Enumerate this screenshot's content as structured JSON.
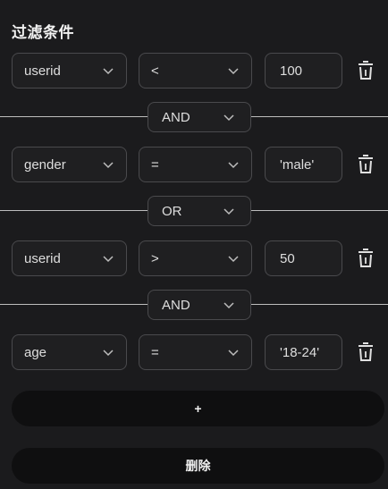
{
  "panel": {
    "title": "过滤条件"
  },
  "conditions": [
    {
      "field": "userid",
      "operator": "<",
      "value": "100"
    },
    {
      "field": "gender",
      "operator": "=",
      "value": "'male'"
    },
    {
      "field": "userid",
      "operator": ">",
      "value": "50"
    },
    {
      "field": "age",
      "operator": "=",
      "value": "'18-24'"
    }
  ],
  "connectors": [
    "AND",
    "OR",
    "AND"
  ],
  "buttons": {
    "add_label": "+",
    "delete_label": "删除"
  },
  "icons": {
    "dropdown": "chevron-down-icon",
    "delete_row": "trash-icon"
  },
  "colors": {
    "background": "#1b1b1d",
    "control_border": "#4a4a4d",
    "button_background": "#0f0f10",
    "text": "#dedede"
  }
}
